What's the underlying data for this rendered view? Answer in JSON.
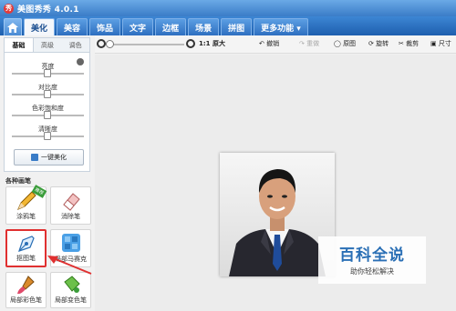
{
  "app": {
    "title": "美图秀秀 4.0.1",
    "icon_glyph": "秀"
  },
  "nav": {
    "tabs": [
      "美化",
      "美容",
      "饰品",
      "文字",
      "边框",
      "场景",
      "拼图",
      "更多功能 ▾"
    ],
    "active_index": 0
  },
  "toolbar": {
    "zoom_label": "1:1 原大",
    "undo": "撤销",
    "redo": "重做",
    "original": "原图",
    "rotate": "旋转",
    "crop": "裁剪",
    "size": "尺寸"
  },
  "sidebar": {
    "subtabs": [
      "基础",
      "高级",
      "调色"
    ],
    "adjustments": [
      {
        "label": "亮度",
        "value": 0.5
      },
      {
        "label": "对比度",
        "value": 0.5
      },
      {
        "label": "色彩饱和度",
        "value": 0.5
      },
      {
        "label": "清晰度",
        "value": 0.5
      }
    ],
    "one_click": "一键美化"
  },
  "brushes": {
    "section_title": "各种画笔",
    "items": [
      {
        "label": "涂鸦笔",
        "badge": "推荐"
      },
      {
        "label": "消除笔"
      },
      {
        "label": "抠图笔"
      },
      {
        "label": "局部马赛克"
      },
      {
        "label": "局部彩色笔"
      },
      {
        "label": "局部变色笔"
      }
    ]
  },
  "watermark": {
    "main": "百科全说",
    "sub": "助你轻松解决"
  },
  "colors": {
    "accent": "#2e6fc0",
    "highlight": "#e03030"
  }
}
